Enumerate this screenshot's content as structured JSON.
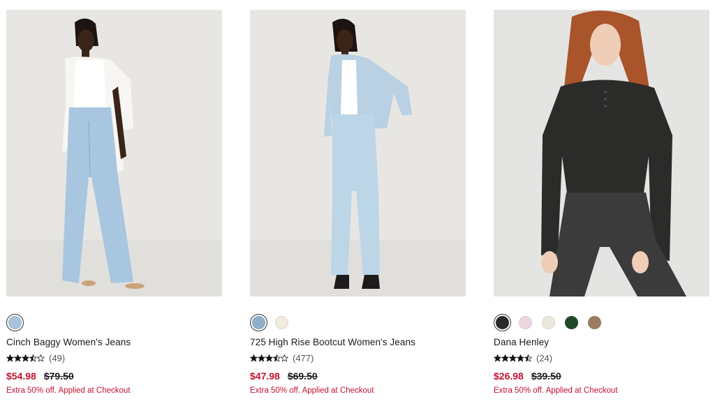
{
  "products": [
    {
      "name": "Cinch Baggy Women's Jeans",
      "rating": 3.5,
      "review_count": "(49)",
      "sale_price": "$54.98",
      "original_price": "$79.50",
      "promo": "Extra 50% off. Applied at Checkout",
      "swatches": [
        {
          "color": "#a7c4dc",
          "selected": true
        }
      ]
    },
    {
      "name": "725 High Rise Bootcut Women's Jeans",
      "rating": 3.5,
      "review_count": "(477)",
      "sale_price": "$47.98",
      "original_price": "$69.50",
      "promo": "Extra 50% off. Applied at Checkout",
      "swatches": [
        {
          "color": "#8fb0c8",
          "selected": true
        },
        {
          "color": "#f1ebe0",
          "selected": false
        }
      ]
    },
    {
      "name": "Dana Henley",
      "rating": 4.5,
      "review_count": "(24)",
      "sale_price": "$26.98",
      "original_price": "$39.50",
      "promo": "Extra 50% off. Applied at Checkout",
      "swatches": [
        {
          "color": "#2a2a2a",
          "selected": true
        },
        {
          "color": "#ecd7e0",
          "selected": false
        },
        {
          "color": "#ebe8de",
          "selected": false
        },
        {
          "color": "#1f4a2a",
          "selected": false
        },
        {
          "color": "#9b7d62",
          "selected": false
        }
      ]
    }
  ]
}
